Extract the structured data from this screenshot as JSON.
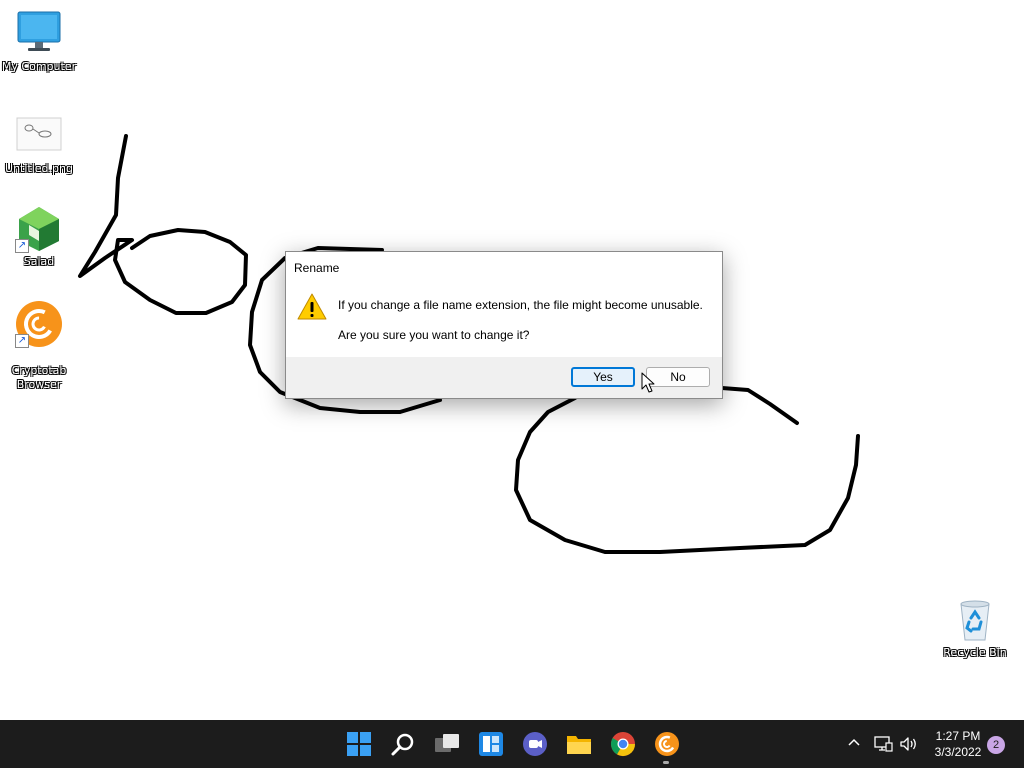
{
  "desktop": {
    "icons": [
      {
        "label": "My Computer",
        "icon": "monitor-icon"
      },
      {
        "label": "Untitled.png",
        "icon": "image-file-icon"
      },
      {
        "label": "Salad",
        "icon": "salad-icon"
      },
      {
        "label": "Cryptotab Browser",
        "icon": "cryptotab-icon"
      },
      {
        "label": "Recycle Bin",
        "icon": "recycle-bin-icon"
      }
    ]
  },
  "dialog": {
    "title": "Rename",
    "message": "If you change a file name extension, the file might become unusable.",
    "question": "Are you sure you want to change it?",
    "yes_label": "Yes",
    "no_label": "No",
    "icon": "warning-icon"
  },
  "taskbar": {
    "apps": [
      "start-icon",
      "search-icon",
      "task-view-icon",
      "widgets-icon",
      "teams-chat-icon",
      "file-explorer-icon",
      "chrome-icon",
      "cryptotab-icon"
    ],
    "time": "1:27 PM",
    "date": "3/3/2022",
    "notification_count": "2"
  },
  "colors": {
    "accent": "#0078d7",
    "taskbar": "#1c1c1c",
    "cryptotab_orange": "#f7931a"
  }
}
